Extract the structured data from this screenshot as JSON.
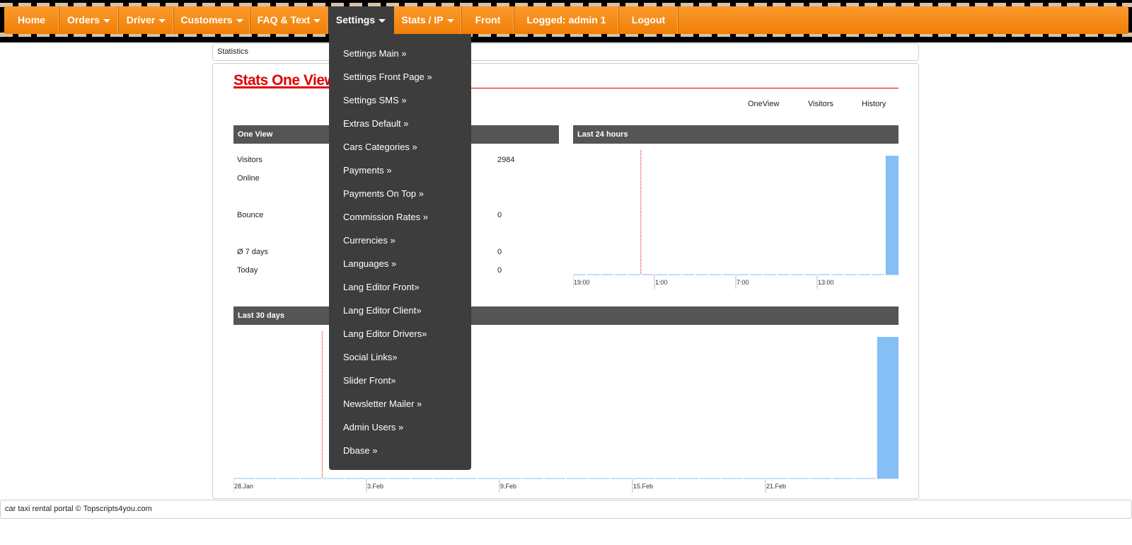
{
  "nav": {
    "items": [
      {
        "label": "Home",
        "caret": false
      },
      {
        "label": "Orders",
        "caret": true
      },
      {
        "label": "Driver",
        "caret": true
      },
      {
        "label": "Customers",
        "caret": true
      },
      {
        "label": "FAQ & Text",
        "caret": true
      },
      {
        "label": "Settings",
        "caret": true,
        "active": true
      },
      {
        "label": "Stats / IP",
        "caret": true
      },
      {
        "label": "Front",
        "caret": false
      },
      {
        "label": "Logged: admin 1",
        "caret": false
      },
      {
        "label": "Logout",
        "caret": false
      }
    ]
  },
  "breadcrumb": "Statistics",
  "page": {
    "title": "Stats One View",
    "tabs": [
      "OneView",
      "Visitors",
      "History"
    ]
  },
  "one_view": {
    "heading": "One View",
    "rows": [
      {
        "label": "Visitors",
        "value": "2984"
      },
      {
        "label": "Online",
        "value": ""
      },
      {
        "label": "Bounce",
        "value": "0"
      },
      {
        "label": "Ø 7 days",
        "value": "0"
      },
      {
        "label": "Today",
        "value": "0"
      }
    ]
  },
  "settings_menu": {
    "items": [
      "Settings Main »",
      "Settings Front Page »",
      "Settings SMS »",
      "Extras Default »",
      "Cars Categories »",
      "Payments »",
      "Payments On Top »",
      "Commission Rates »",
      "Currencies »",
      "Languages »",
      "Lang Editor Front»",
      "Lang Editor Client»",
      "Lang Editor Drivers»",
      "Social Links»",
      "Slider Front»",
      "Newsletter Mailer »",
      "Admin Users »",
      "Dbase »"
    ]
  },
  "footer": "car taxi rental portal © Topscripts4you.com",
  "colors": {
    "nav_orange": "#f7901e",
    "menu_dark": "#3d3d3d",
    "title_red": "#e00000",
    "bar_blue": "#85bff5",
    "marker_red": "#e00000"
  },
  "chart_data": [
    {
      "type": "bar",
      "title": "Last 24 hours",
      "tick_labels": [
        "19:00",
        "1:00",
        "7:00",
        "13:00"
      ],
      "bar_count": 24,
      "values": [
        0,
        0,
        0,
        0,
        0,
        0,
        0,
        0,
        0,
        0,
        0,
        0,
        0,
        0,
        0,
        0,
        0,
        0,
        0,
        0,
        0,
        0,
        0,
        1
      ],
      "marker_index": 5
    },
    {
      "type": "bar",
      "title": "Last 30 days",
      "tick_labels": [
        "28.Jan",
        "3.Feb",
        "9.Feb",
        "15.Feb",
        "21.Feb"
      ],
      "bar_count": 30,
      "values": [
        0,
        0,
        0,
        0,
        0,
        0,
        0,
        0,
        0,
        0,
        0,
        0,
        0,
        0,
        0,
        0,
        0,
        0,
        0,
        0,
        0,
        0,
        0,
        0,
        0,
        0,
        0,
        0,
        0,
        1
      ],
      "marker_index": 4
    }
  ]
}
